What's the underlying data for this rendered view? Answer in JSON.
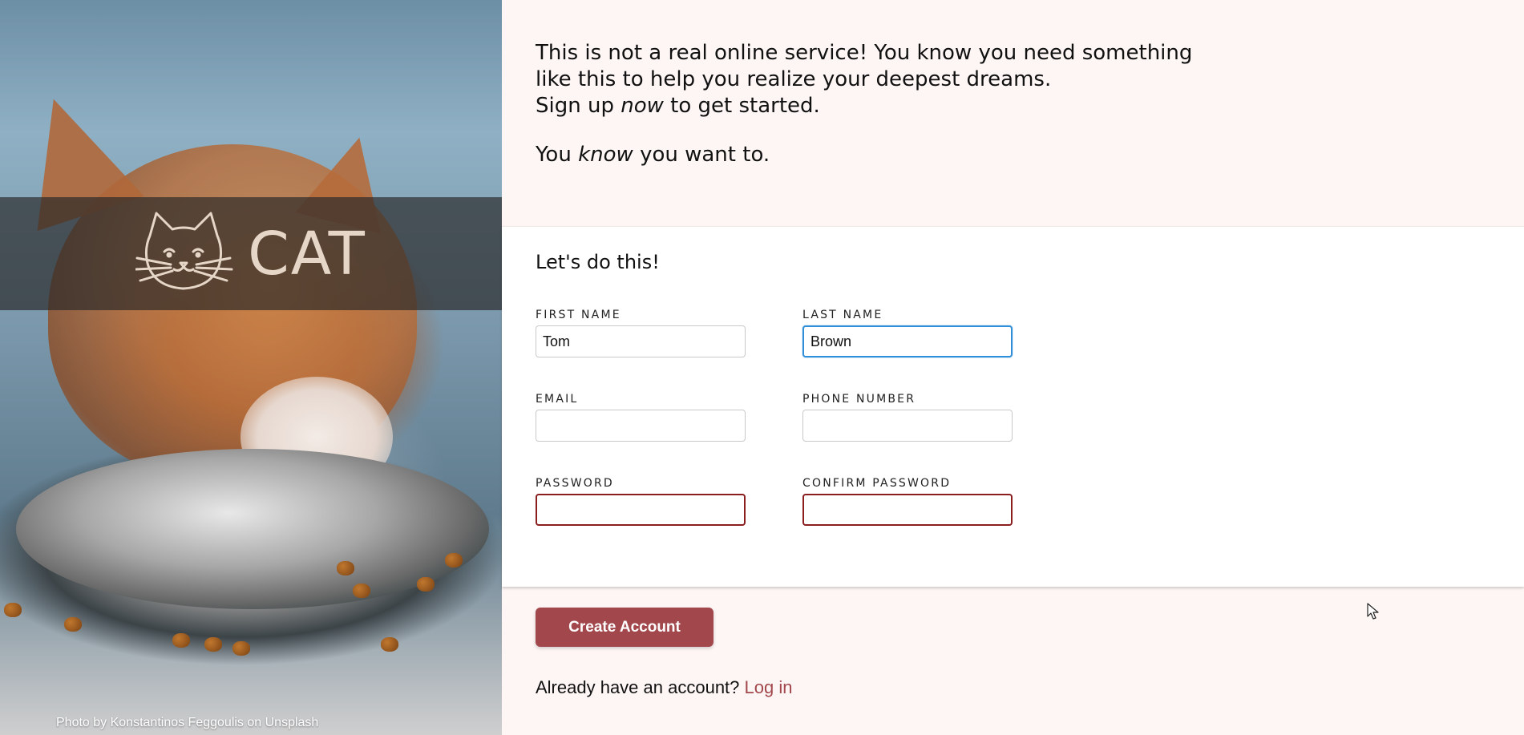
{
  "hero": {
    "logo_text": "CAT",
    "photo_credit": "Photo by Konstantinos Feggoulis on Unsplash"
  },
  "intro": {
    "line1": "This is not a real online service! You know you need something",
    "line2": "like this to help you realize your deepest dreams.",
    "line3_before": "Sign up ",
    "line3_em": "now",
    "line3_after": " to get started.",
    "tagline_before": "You ",
    "tagline_em": "know",
    "tagline_after": " you want to."
  },
  "form": {
    "title": "Let's do this!",
    "first_name": {
      "label": "FIRST NAME",
      "value": "Tom"
    },
    "last_name": {
      "label": "LAST NAME",
      "value": "Brown"
    },
    "email": {
      "label": "EMAIL",
      "value": ""
    },
    "phone": {
      "label": "PHONE NUMBER",
      "value": ""
    },
    "password": {
      "label": "PASSWORD",
      "value": ""
    },
    "confirm_password": {
      "label": "CONFIRM PASSWORD",
      "value": ""
    }
  },
  "actions": {
    "create_label": "Create Account",
    "already_text": "Already have an account?",
    "login_label": "Log in"
  },
  "colors": {
    "accent": "#a2474c",
    "focus_border": "#2f8fd8",
    "error_border": "#8a1e1e",
    "page_bg": "#fdf6f5"
  },
  "icons": [
    "cat-logo-icon",
    "mouse-pointer-icon"
  ]
}
